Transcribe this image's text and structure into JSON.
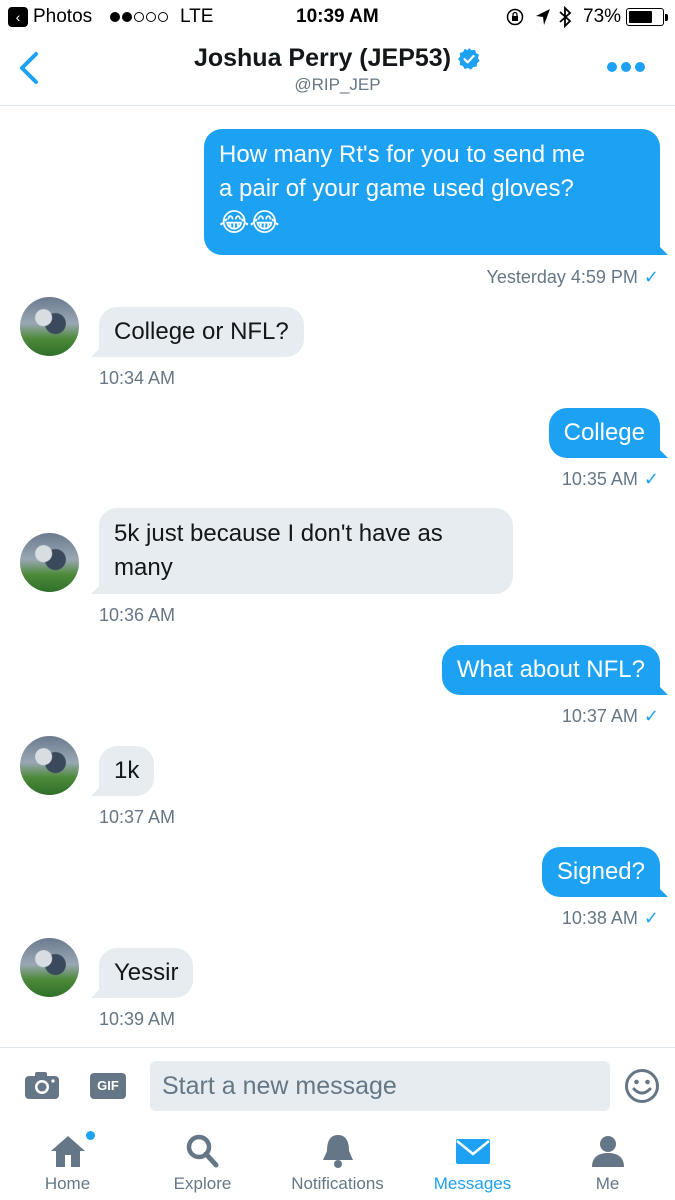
{
  "status_bar": {
    "back_app": "Photos",
    "carrier": "LTE",
    "time": "10:39 AM",
    "battery": "73%",
    "battery_level": 0.73,
    "signal_bars_filled": 2,
    "signal_bars_total": 5
  },
  "header": {
    "name": "Joshua Perry (JEP53)",
    "handle": "@RIP_JEP",
    "verified": true
  },
  "messages": [
    {
      "dir": "out",
      "lines": [
        "How many Rt's for you to send me",
        "a pair of your game used gloves?",
        "😂😂"
      ],
      "time": "Yesterday 4:59 PM"
    },
    {
      "dir": "in",
      "lines": [
        "College or NFL?"
      ],
      "time": "10:34 AM"
    },
    {
      "dir": "out",
      "lines": [
        "College"
      ],
      "time": "10:35 AM"
    },
    {
      "dir": "in",
      "lines": [
        "5k just because I don't have as",
        "many"
      ],
      "time": "10:36 AM"
    },
    {
      "dir": "out",
      "lines": [
        "What about NFL?"
      ],
      "time": "10:37 AM"
    },
    {
      "dir": "in",
      "lines": [
        "1k"
      ],
      "time": "10:37 AM"
    },
    {
      "dir": "out",
      "lines": [
        "Signed?"
      ],
      "time": "10:38 AM"
    },
    {
      "dir": "in",
      "lines": [
        "Yessir"
      ],
      "time": "10:39 AM"
    }
  ],
  "composer": {
    "placeholder": "Start a new message",
    "gif_label": "GIF"
  },
  "tabs": [
    {
      "label": "Home",
      "icon": "home-icon",
      "active": false,
      "badge": true
    },
    {
      "label": "Explore",
      "icon": "search-icon",
      "active": false,
      "badge": false
    },
    {
      "label": "Notifications",
      "icon": "bell-icon",
      "active": false,
      "badge": false
    },
    {
      "label": "Messages",
      "icon": "envelope-icon",
      "active": true,
      "badge": false
    },
    {
      "label": "Me",
      "icon": "person-icon",
      "active": false,
      "badge": false
    }
  ],
  "colors": {
    "accent": "#1da1f2",
    "incoming_bubble": "#e6ecf0",
    "muted": "#657786"
  }
}
